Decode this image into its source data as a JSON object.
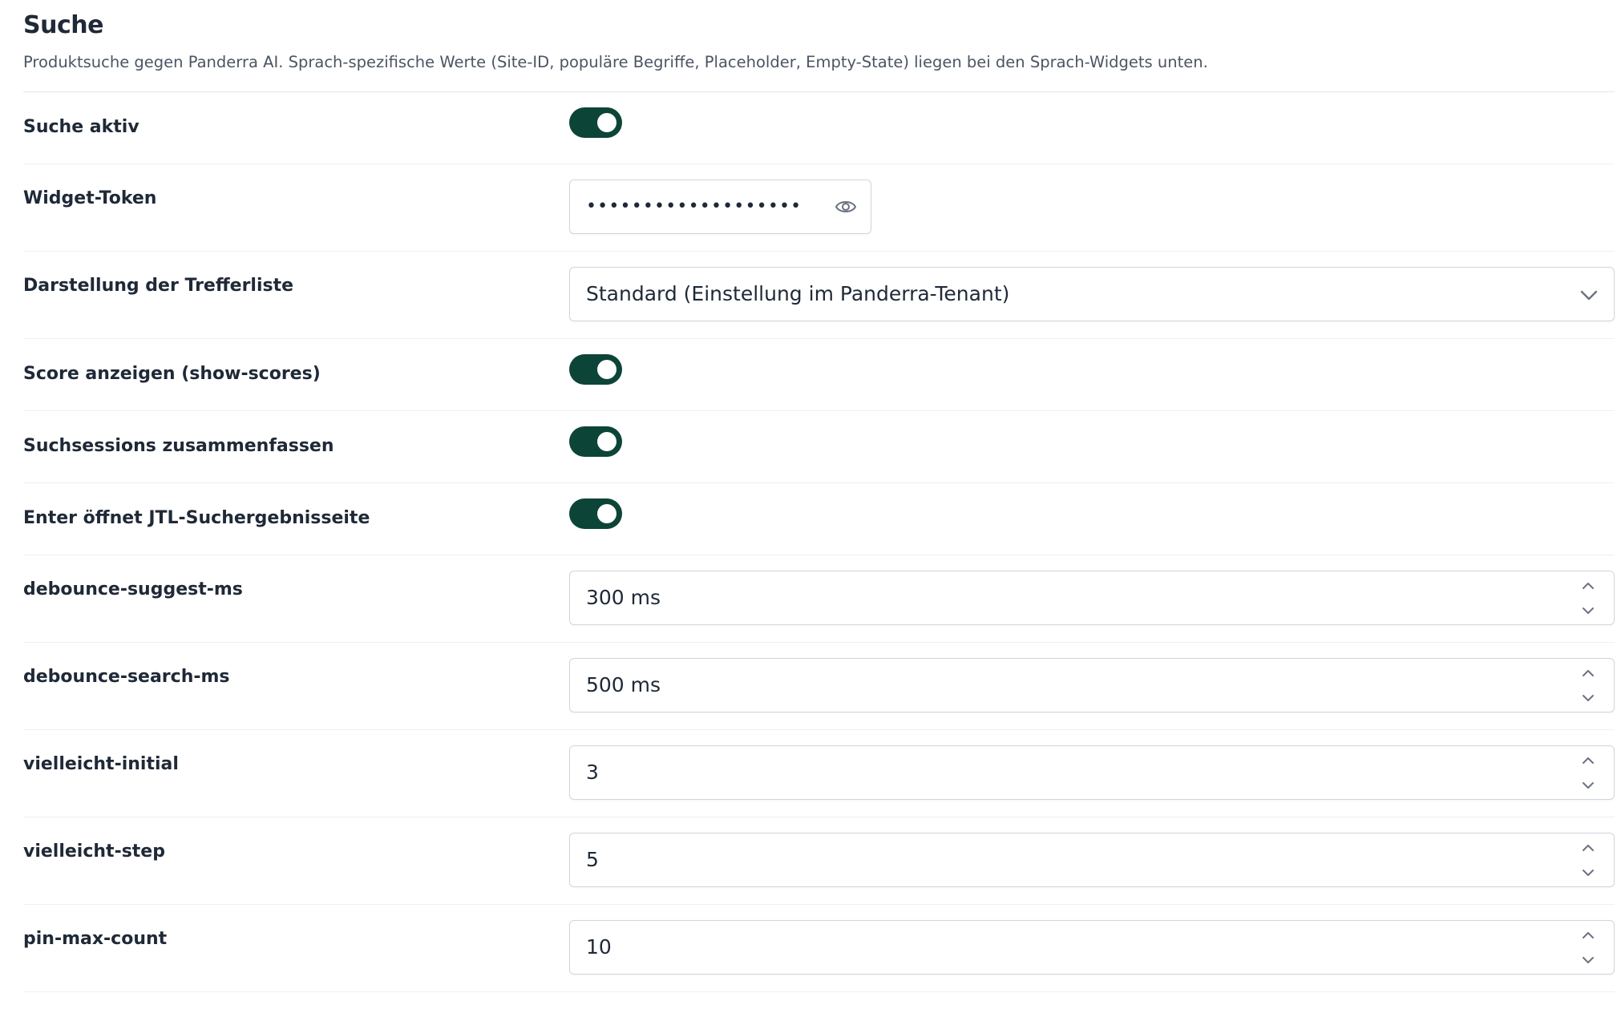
{
  "section": {
    "title": "Suche",
    "description": "Produktsuche gegen Panderra AI. Sprach-spezifische Werte (Site-ID, populäre Begriffe, Placeholder, Empty-State) liegen bei den Sprach-Widgets unten."
  },
  "settings": {
    "search_active": {
      "label": "Suche aktiv",
      "enabled": true
    },
    "widget_token": {
      "label": "Widget-Token",
      "masked_value": "•••••••••••••••••••",
      "reveal_icon": "eye-icon"
    },
    "result_display": {
      "label": "Darstellung der Trefferliste",
      "selected": "Standard (Einstellung im Panderra-Tenant)",
      "dropdown_icon": "chevron-down-icon"
    },
    "show_scores": {
      "label": "Score anzeigen (show-scores)",
      "enabled": true
    },
    "merge_sessions": {
      "label": "Suchsessions zusammenfassen",
      "enabled": true
    },
    "enter_opens_jtl": {
      "label": "Enter öffnet JTL-Suchergebnisseite",
      "enabled": true
    },
    "debounce_suggest": {
      "label": "debounce-suggest-ms",
      "value": "300 ms"
    },
    "debounce_search": {
      "label": "debounce-search-ms",
      "value": "500 ms"
    },
    "vielleicht_initial": {
      "label": "vielleicht-initial",
      "value": "3"
    },
    "vielleicht_step": {
      "label": "vielleicht-step",
      "value": "5"
    },
    "pin_max_count": {
      "label": "pin-max-count",
      "value": "10"
    }
  },
  "colors": {
    "toggle_on": "#0d4438",
    "text": "#1f2937",
    "muted_text": "#4b5563",
    "border": "#d1d5db",
    "icon": "#6b7280"
  }
}
